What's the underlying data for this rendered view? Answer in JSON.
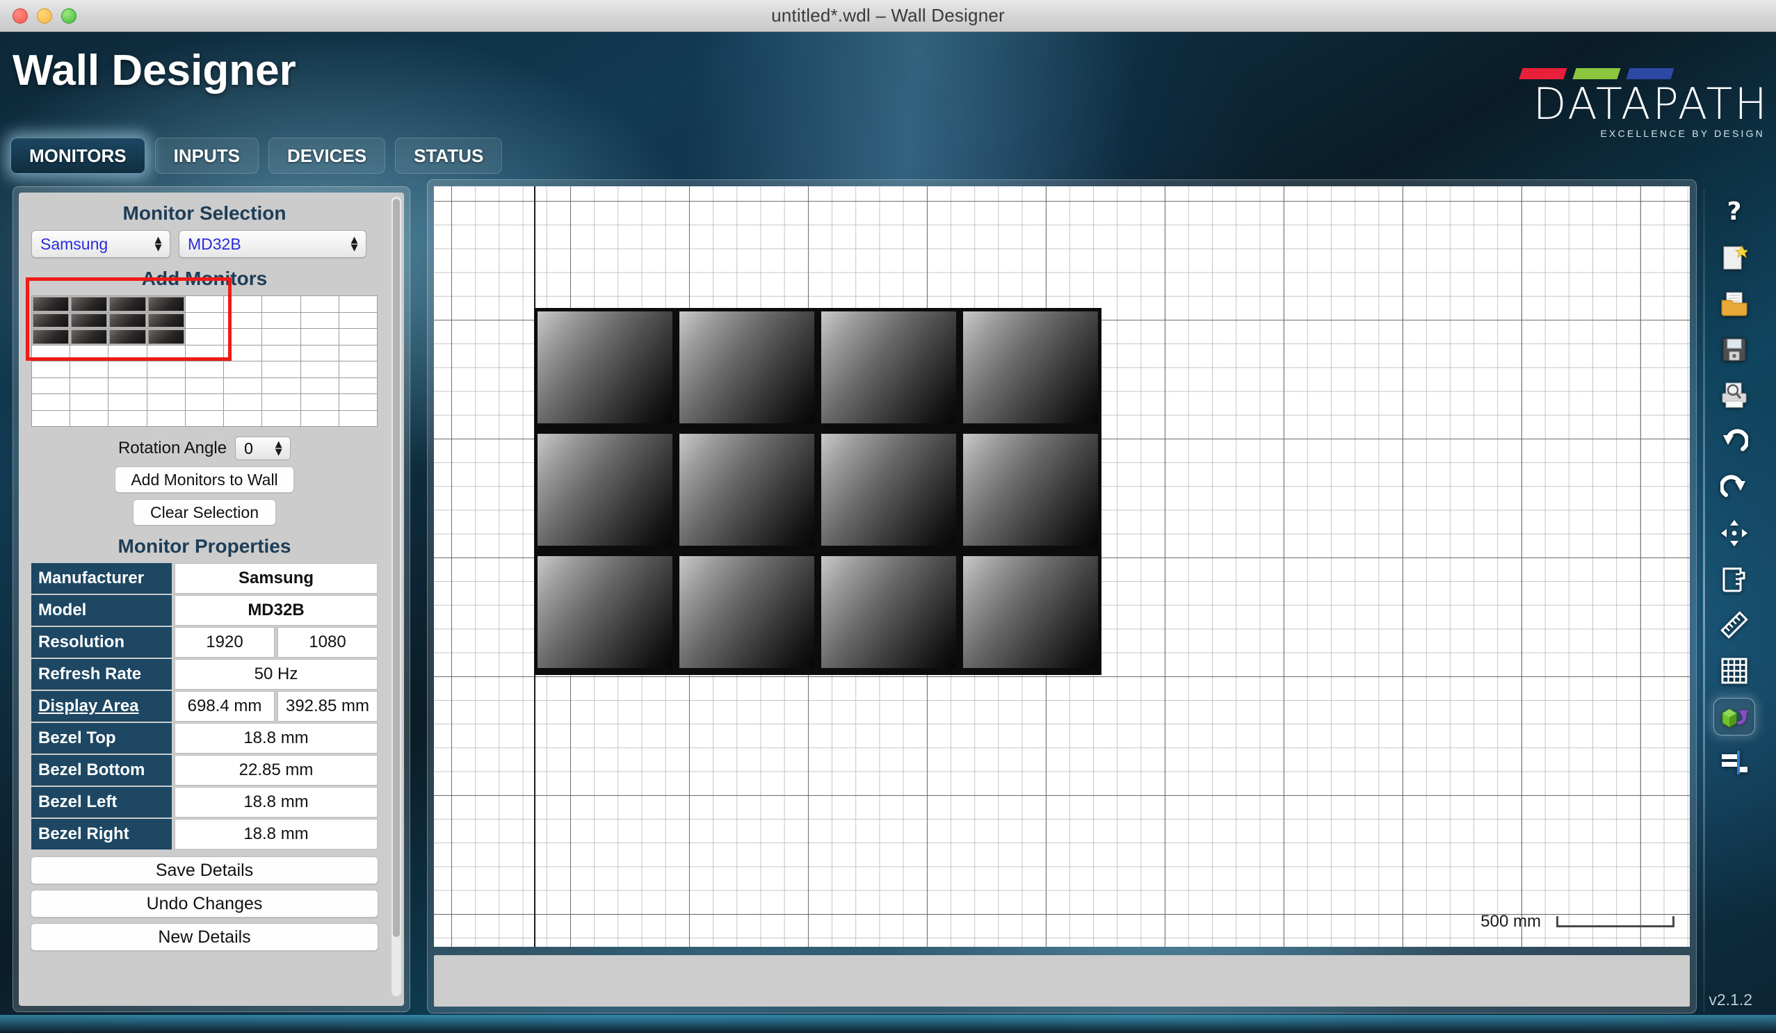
{
  "window": {
    "title": "untitled*.wdl – Wall Designer",
    "traffic_lights": [
      "close",
      "minimize",
      "zoom"
    ]
  },
  "header": {
    "app_title": "Wall Designer",
    "logo": {
      "word": "DATAPATH",
      "tagline": "EXCELLENCE BY DESIGN",
      "bar_colors": [
        "#e8203a",
        "#8cc63f",
        "#2c49a6"
      ]
    }
  },
  "tabs": [
    {
      "label": "MONITORS",
      "active": true
    },
    {
      "label": "INPUTS",
      "active": false
    },
    {
      "label": "DEVICES",
      "active": false
    },
    {
      "label": "STATUS",
      "active": false
    }
  ],
  "monitor_selection": {
    "title": "Monitor Selection",
    "manufacturer": {
      "value": "Samsung"
    },
    "model": {
      "value": "MD32B"
    }
  },
  "add_monitors": {
    "title": "Add Monitors",
    "grid": {
      "columns": 9,
      "rows": 8,
      "selected_columns": 4,
      "selected_rows": 3
    },
    "rotation_label": "Rotation Angle",
    "rotation_value": "0",
    "add_button": "Add Monitors to Wall",
    "clear_button": "Clear Selection"
  },
  "monitor_properties": {
    "title": "Monitor Properties",
    "rows": [
      {
        "label": "Manufacturer",
        "values": [
          "Samsung"
        ],
        "bold": true,
        "underline": false
      },
      {
        "label": "Model",
        "values": [
          "MD32B"
        ],
        "bold": true,
        "underline": false
      },
      {
        "label": "Resolution",
        "values": [
          "1920",
          "1080"
        ],
        "bold": false,
        "underline": false
      },
      {
        "label": "Refresh Rate",
        "values": [
          "50 Hz"
        ],
        "bold": false,
        "underline": false
      },
      {
        "label": "Display Area",
        "values": [
          "698.4 mm",
          "392.85 mm"
        ],
        "bold": false,
        "underline": true
      },
      {
        "label": "Bezel Top",
        "values": [
          "18.8 mm"
        ],
        "bold": false,
        "underline": false
      },
      {
        "label": "Bezel Bottom",
        "values": [
          "22.85 mm"
        ],
        "bold": false,
        "underline": false
      },
      {
        "label": "Bezel Left",
        "values": [
          "18.8 mm"
        ],
        "bold": false,
        "underline": false
      },
      {
        "label": "Bezel Right",
        "values": [
          "18.8 mm"
        ],
        "bold": false,
        "underline": false
      }
    ]
  },
  "detail_buttons": [
    {
      "label": "Save Details"
    },
    {
      "label": "Undo Changes"
    },
    {
      "label": "New Details"
    }
  ],
  "canvas": {
    "wall": {
      "columns": 4,
      "rows": 3,
      "total_monitors": 12
    },
    "scale_label": "500 mm"
  },
  "toolbar": [
    {
      "name": "help-icon",
      "title": "Help"
    },
    {
      "name": "new-document-icon",
      "title": "New"
    },
    {
      "name": "open-folder-icon",
      "title": "Open"
    },
    {
      "name": "save-floppy-icon",
      "title": "Save"
    },
    {
      "name": "print-preview-icon",
      "title": "Print Preview"
    },
    {
      "name": "undo-icon",
      "title": "Undo"
    },
    {
      "name": "redo-icon",
      "title": "Redo"
    },
    {
      "name": "move-icon",
      "title": "Move"
    },
    {
      "name": "measure-jug-icon",
      "title": "Measure"
    },
    {
      "name": "ruler-icon",
      "title": "Ruler"
    },
    {
      "name": "grid-icon",
      "title": "Grid"
    },
    {
      "name": "rotate-3d-icon",
      "title": "3D View",
      "active": true
    },
    {
      "name": "align-icon",
      "title": "Align"
    }
  ],
  "version": "v2.1.2"
}
